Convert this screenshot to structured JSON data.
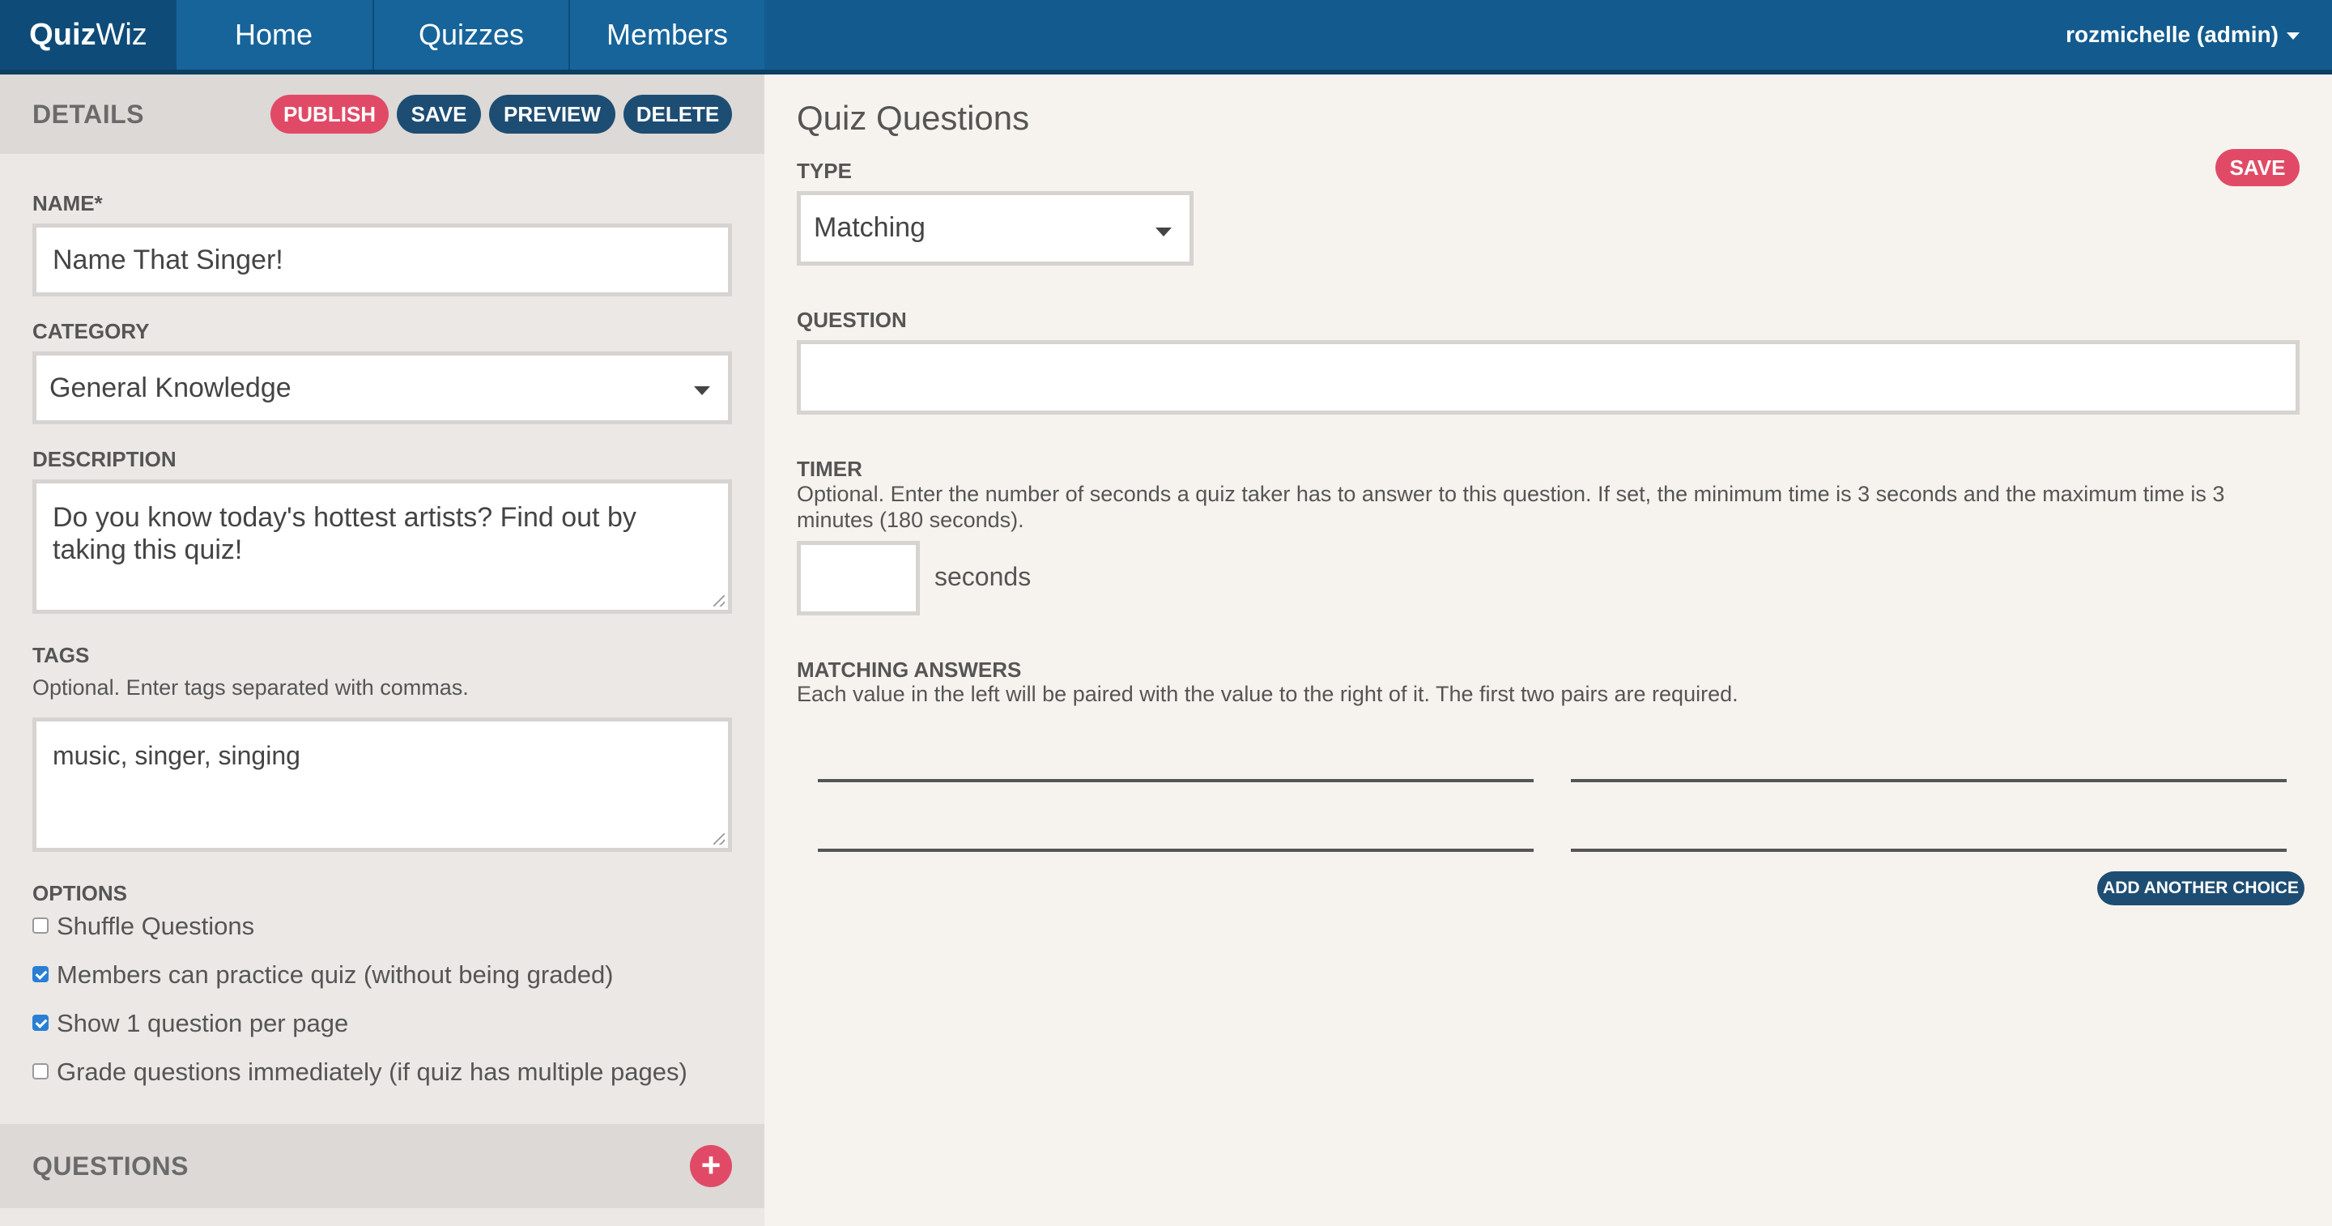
{
  "nav": {
    "brand_bold": "Quiz",
    "brand_light": "Wiz",
    "links": [
      "Home",
      "Quizzes",
      "Members"
    ],
    "user": "rozmichelle (admin)"
  },
  "details": {
    "title": "DETAILS",
    "buttons": {
      "publish": "PUBLISH",
      "save": "SAVE",
      "preview": "PREVIEW",
      "delete": "DELETE"
    },
    "name_label": "NAME*",
    "name_value": "Name That Singer!",
    "category_label": "CATEGORY",
    "category_value": "General Knowledge",
    "description_label": "DESCRIPTION",
    "description_value": "Do you know today's hottest artists? Find out by taking this quiz!",
    "tags_label": "TAGS",
    "tags_help": "Optional. Enter tags separated with commas.",
    "tags_value": "music, singer, singing",
    "options_label": "OPTIONS",
    "options": [
      {
        "label": "Shuffle Questions",
        "checked": false
      },
      {
        "label": "Members can practice quiz (without being graded)",
        "checked": true
      },
      {
        "label": "Show 1 question per page",
        "checked": true
      },
      {
        "label": "Grade questions immediately (if quiz has multiple pages)",
        "checked": false
      }
    ]
  },
  "questions_section": {
    "title": "QUESTIONS"
  },
  "quiz_questions": {
    "title": "Quiz Questions",
    "save": "SAVE",
    "type_label": "TYPE",
    "type_value": "Matching",
    "question_label": "QUESTION",
    "question_value": "",
    "timer_label": "TIMER",
    "timer_help": "Optional. Enter the number of seconds a quiz taker has to answer to this question. If set, the minimum time is 3 seconds and the maximum time is 3 minutes (180 seconds).",
    "timer_value": "",
    "timer_unit": "seconds",
    "matching_label": "MATCHING ANSWERS",
    "matching_help": "Each value in the left will be paired with the value to the right of it. The first two pairs are required.",
    "add_choice": "ADD ANOTHER CHOICE"
  },
  "colors": {
    "nav": "#135b8e",
    "accent_red": "#e14a66",
    "accent_blue": "#1e4d73"
  }
}
